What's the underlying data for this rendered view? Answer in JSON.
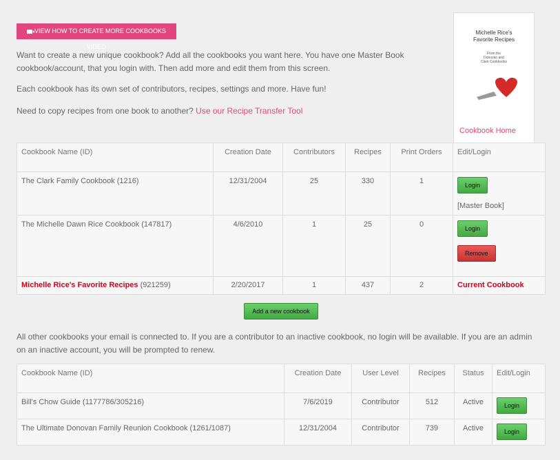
{
  "video_button": "VIEW HOW TO CREATE MORE COOKBOOKS VIDEO",
  "intro": "Want to create a new unique cookbook? Add all the cookbooks you want here. You have one Master Book cookbook/account, that you login with. Then add more and edit them from this screen.",
  "intro2": "Each cookbook has its own set of contributors, recipes, settings and more. Have fun!",
  "transfer_text": "Need to copy recipes from one book to another?",
  "transfer_link": "Use our Recipe Transfer Tool",
  "cover": {
    "title": "Michelle Rice's Favorite Recipes",
    "subtitle": "From the Donovan and Clark Cookbooks",
    "home_link": "Cookbook Home"
  },
  "table1": {
    "headers": [
      "Cookbook Name (ID)",
      "Creation Date",
      "Contributors",
      "Recipes",
      "Print Orders",
      "Edit/Login"
    ],
    "rows": [
      {
        "name": "The Clark Family Cookbook (1216)",
        "date": "12/31/2004",
        "contributors": "25",
        "recipes": "330",
        "orders": "1",
        "login": "Login",
        "note": "[Master Book]"
      },
      {
        "name": "The Michelle Dawn Rice Cookbook (147817)",
        "date": "4/6/2010",
        "contributors": "1",
        "recipes": "25",
        "orders": "0",
        "login": "Login",
        "remove": "Remove"
      },
      {
        "name": "Michelle Rice's Favorite Recipes",
        "id": "(921259)",
        "date": "2/20/2017",
        "contributors": "1",
        "recipes": "437",
        "orders": "2",
        "status": "Current Cookbook"
      }
    ]
  },
  "add_button": "Add a new cookbook",
  "other_text": "All other cookbooks your email is connected to. If you are a contributor to an inactive cookbook, no login will be available. If you are an admin on an inactive account, you will be prompted to renew.",
  "table2": {
    "headers": [
      "Cookbook Name (ID)",
      "Creation Date",
      "User Level",
      "Recipes",
      "Status",
      "Edit/Login"
    ],
    "rows": [
      {
        "name": "Bill's Chow Guide (1177786/305216)",
        "date": "7/6/2019",
        "level": "Contributor",
        "recipes": "512",
        "status": "Active",
        "login": "Login"
      },
      {
        "name": "The Ultimate Donovan Family Reunion Cookbook (1261/1087)",
        "date": "12/31/2004",
        "level": "Contributor",
        "recipes": "739",
        "status": "Active",
        "login": "Login"
      }
    ]
  }
}
